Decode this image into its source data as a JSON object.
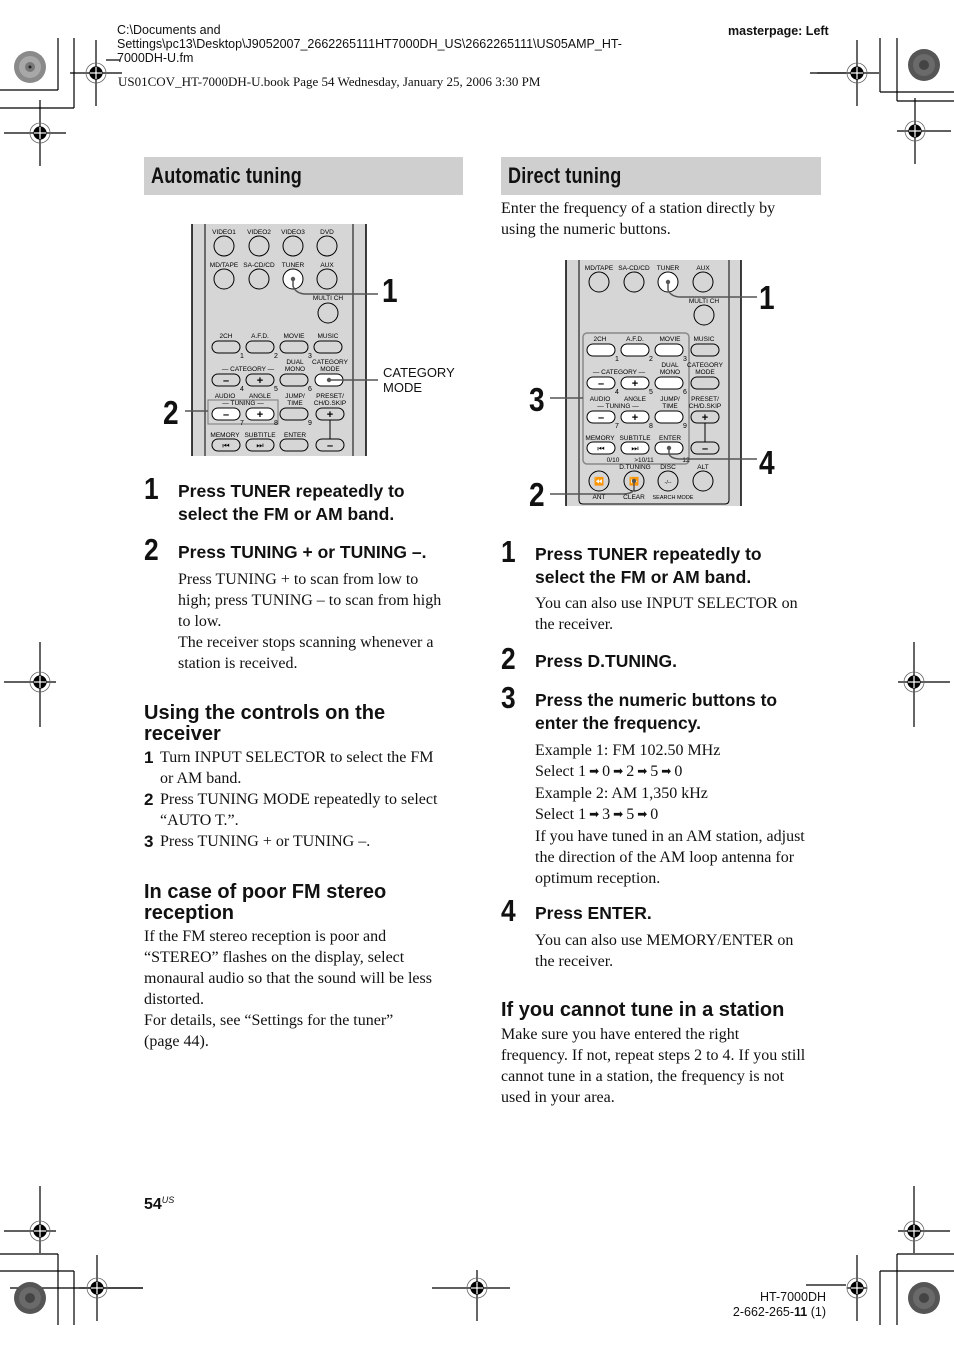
{
  "header": {
    "file_path_lines": [
      "C:\\Documents and",
      "Settings\\pc13\\Desktop\\J9052007_2662265111HT7000DH_US\\2662265111\\US05AMP_HT-",
      "7000DH-U.fm"
    ],
    "masterpage": "masterpage: Left",
    "book_line": "US01COV_HT-7000DH-U.book  Page 54  Wednesday, January 25, 2006  3:30 PM"
  },
  "automatic_tuning": {
    "title": "Automatic tuning",
    "remote": {
      "row1": [
        "VIDEO1",
        "VIDEO2",
        "VIDEO3",
        "DVD"
      ],
      "row2": [
        "MD/TAPE",
        "SA-CD/CD",
        "TUNER",
        "AUX"
      ],
      "multich": "MULTI CH",
      "row3": [
        "2CH",
        "A.F.D.",
        "MOVIE",
        "MUSIC"
      ],
      "category": "— CATEGORY —",
      "dual_mono": [
        "DUAL",
        "MONO"
      ],
      "category_mode": [
        "CATEGORY",
        "MODE"
      ],
      "audio": "AUDIO",
      "angle": "ANGLE",
      "tuning": "— TUNING —",
      "jump_time": [
        "JUMP/",
        "TIME"
      ],
      "preset": [
        "PRESET/",
        "CH/D.SKIP"
      ],
      "row_last": [
        "MEMORY",
        "SUBTITLE",
        "ENTER"
      ],
      "digits": [
        "1",
        "2",
        "3",
        "4",
        "5",
        "6",
        "7",
        "8",
        "9"
      ],
      "plus": "+",
      "minus": "–"
    },
    "callouts": {
      "one": "1",
      "two": "2",
      "category_mode_label": [
        "CATEGORY",
        "MODE"
      ]
    },
    "steps": [
      {
        "num": "1",
        "title_lines": [
          "Press TUNER repeatedly to",
          "select the FM or AM band."
        ],
        "body": []
      },
      {
        "num": "2",
        "title_lines": [
          "Press TUNING + or TUNING –."
        ],
        "body": [
          "Press TUNING + to scan from low to",
          "high; press TUNING – to scan from high",
          "to low.",
          "The receiver stops scanning whenever a",
          "station is received."
        ]
      }
    ],
    "controls_heading_lines": [
      "Using the controls on the",
      "receiver"
    ],
    "controls_items": [
      {
        "num": "1",
        "lines": [
          "Turn INPUT SELECTOR to select the FM",
          "or AM band."
        ]
      },
      {
        "num": "2",
        "lines": [
          "Press TUNING MODE repeatedly to select",
          "“AUTO T.”."
        ]
      },
      {
        "num": "3",
        "lines": [
          "Press TUNING + or TUNING –."
        ]
      }
    ],
    "poor_fm_heading_lines": [
      "In case of poor FM stereo",
      "reception"
    ],
    "poor_fm_body": [
      "If the FM stereo reception is poor and",
      "“STEREO” flashes on the display, select",
      "monaural audio so that the sound will be less",
      "distorted.",
      "For details, see “Settings for the tuner”",
      "(page 44)."
    ]
  },
  "direct_tuning": {
    "title": "Direct tuning",
    "intro": [
      "Enter the frequency of a station directly by",
      "using the numeric buttons."
    ],
    "remote": {
      "row2": [
        "MD/TAPE",
        "SA-CD/CD",
        "TUNER",
        "AUX"
      ],
      "multich": "MULTI CH",
      "row3": [
        "2CH",
        "A.F.D.",
        "MOVIE",
        "MUSIC"
      ],
      "category": "— CATEGORY —",
      "dual_mono": [
        "DUAL",
        "MONO"
      ],
      "category_mode": [
        "CATEGORY",
        "MODE"
      ],
      "audio": "AUDIO",
      "angle": "ANGLE",
      "tuning": "— TUNING —",
      "jump_time": [
        "JUMP/",
        "TIME"
      ],
      "preset": [
        "PRESET/",
        "CH/D.SKIP"
      ],
      "row_last": [
        "MEMORY",
        "SUBTITLE",
        "ENTER"
      ],
      "sub_labels": [
        "0/10",
        ">10/11",
        "12"
      ],
      "bottom_top": [
        "D.TUNING",
        "DISC",
        "ALT"
      ],
      "bottom_bottom": [
        "ANT",
        "CLEAR",
        "SEARCH MODE"
      ],
      "disc_glyph": "-/--",
      "digits": [
        "1",
        "2",
        "3",
        "4",
        "5",
        "6",
        "7",
        "8",
        "9"
      ],
      "plus": "+",
      "minus": "–"
    },
    "callouts": {
      "one": "1",
      "two": "2",
      "three": "3",
      "four": "4"
    },
    "steps": [
      {
        "num": "1",
        "title_lines": [
          "Press TUNER repeatedly to",
          "select the FM or AM band."
        ],
        "body": [
          "You can also use INPUT SELECTOR on",
          "the receiver."
        ]
      },
      {
        "num": "2",
        "title_lines": [
          "Press D.TUNING."
        ],
        "body": []
      },
      {
        "num": "3",
        "title_lines": [
          "Press the numeric buttons to",
          "enter the frequency."
        ],
        "body": []
      },
      {
        "num": "4",
        "title_lines": [
          "Press ENTER."
        ],
        "body": [
          "You can also use MEMORY/ENTER on",
          "the receiver."
        ]
      }
    ],
    "examples": {
      "ex1": "Example 1: FM 102.50 MHz",
      "ex1_select": "Select",
      "ex1_seq": [
        "1",
        "0",
        "2",
        "5",
        "0"
      ],
      "ex2": "Example 2: AM 1,350 kHz",
      "ex2_select": "Select",
      "ex2_seq": [
        "1",
        "3",
        "5",
        "0"
      ],
      "arrow": "➡",
      "note": [
        "If you have tuned in an AM station, adjust",
        "the direction of the AM loop antenna for",
        "optimum reception."
      ]
    },
    "cannot_tune_heading": "If you cannot tune in a station",
    "cannot_tune_body": [
      "Make sure you have entered the right",
      "frequency. If not, repeat steps 2 to 4. If you still",
      "cannot tune in a station, the frequency is not",
      "used in your area."
    ]
  },
  "footer": {
    "page": "54",
    "page_sup": "US",
    "model": "HT-7000DH",
    "code_prefix": "2-662-265-",
    "code_bold": "11",
    "code_suffix": " (1)"
  }
}
